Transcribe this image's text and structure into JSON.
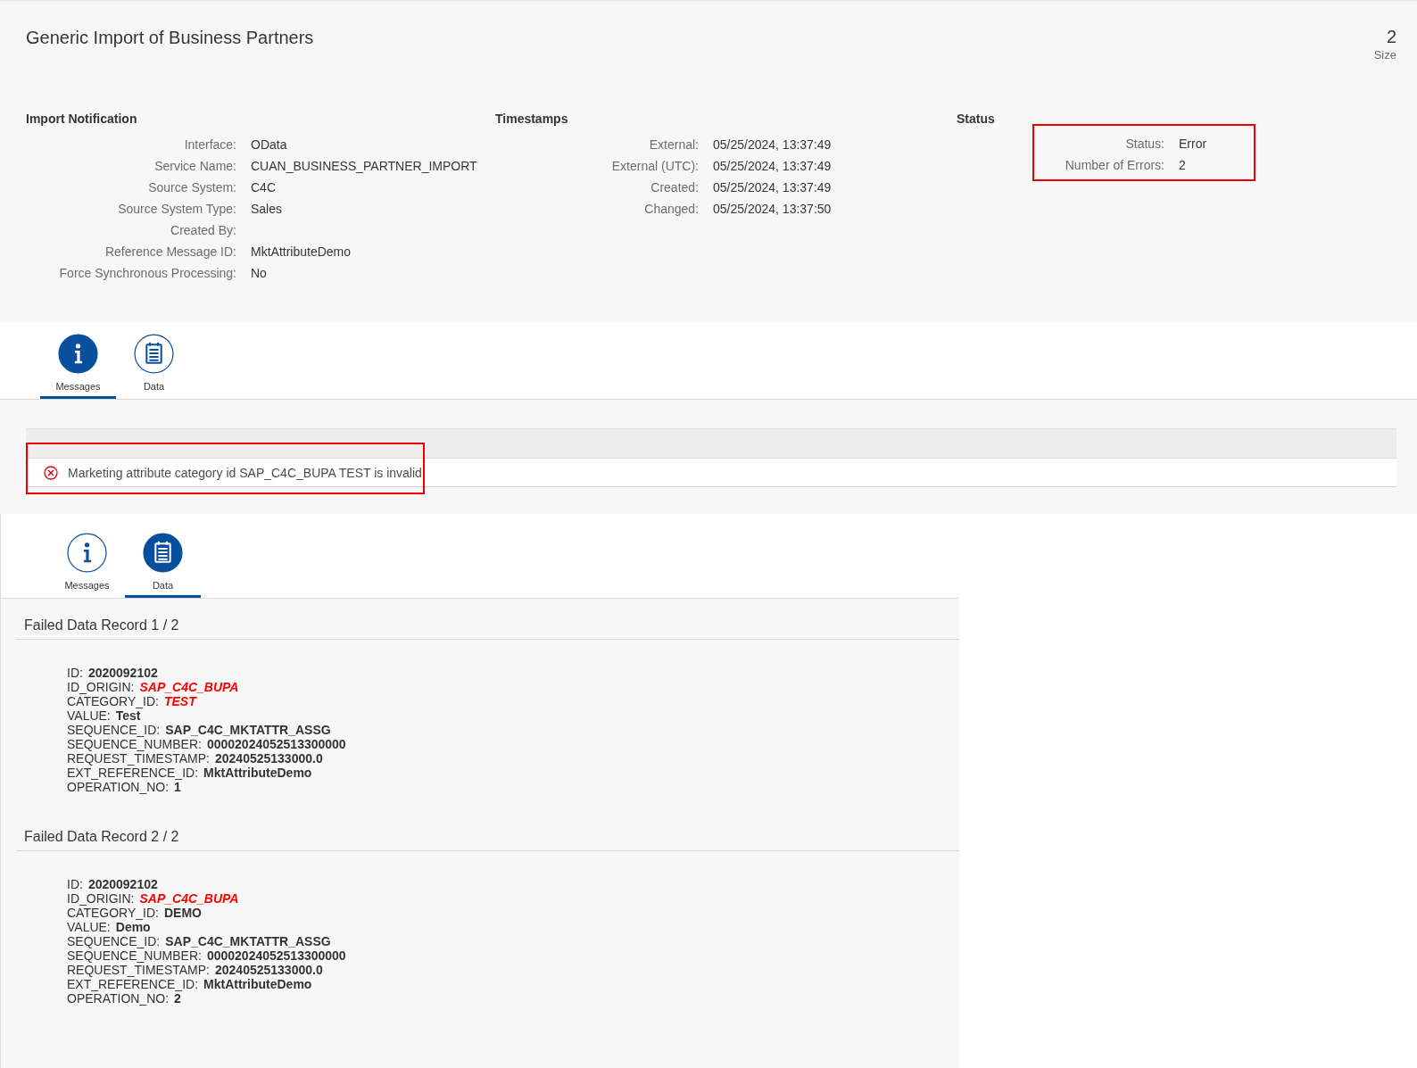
{
  "header": {
    "title": "Generic Import of Business Partners",
    "size_value": "2",
    "size_label": "Size"
  },
  "sections": [
    {
      "title": "Import Notification",
      "highlighted": false,
      "fields": [
        {
          "label": "Interface:",
          "value": "OData"
        },
        {
          "label": "Service Name:",
          "value": "CUAN_BUSINESS_PARTNER_IMPORT"
        },
        {
          "label": "Source System:",
          "value": "C4C"
        },
        {
          "label": "Source System Type:",
          "value": "Sales"
        },
        {
          "label": "Created By:"
        },
        {
          "label": "Reference Message ID:",
          "value": "MktAttributeDemo"
        },
        {
          "label": "Force Synchronous Processing:",
          "value": "No"
        }
      ]
    },
    {
      "title": "Timestamps",
      "highlighted": false,
      "fields": [
        {
          "label": "External:",
          "value": "05/25/2024, 13:37:49"
        },
        {
          "label": "External (UTC):",
          "value": "05/25/2024, 13:37:49"
        },
        {
          "label": "Created:",
          "value": "05/25/2024, 13:37:49"
        },
        {
          "label": "Changed:",
          "value": "05/25/2024, 13:37:50"
        }
      ]
    },
    {
      "title": "Status",
      "highlighted": true,
      "fields": [
        {
          "label": "Status:",
          "value": "Error"
        },
        {
          "label": "Number of Errors:",
          "value": "2"
        }
      ]
    }
  ],
  "tabs_top": [
    {
      "label": "Messages",
      "selected": true
    },
    {
      "label": "Data",
      "selected": false
    }
  ],
  "messages": {
    "highlighted": true,
    "items": [
      {
        "kind": "error",
        "text": "Marketing attribute category id SAP_C4C_BUPA TEST is invalid"
      }
    ]
  },
  "tabs_bottom": [
    {
      "label": "Messages",
      "selected": false
    },
    {
      "label": "Data",
      "selected": true
    }
  ],
  "records": [
    {
      "title": "Failed Data Record 1 / 2",
      "fields": [
        {
          "label": "ID:",
          "value": "2020092102",
          "invalid": false
        },
        {
          "label": "ID_ORIGIN:",
          "value": "SAP_C4C_BUPA",
          "invalid": true
        },
        {
          "label": "CATEGORY_ID:",
          "value": "TEST",
          "invalid": true
        },
        {
          "label": "VALUE:",
          "value": "Test",
          "invalid": false
        },
        {
          "label": "SEQUENCE_ID:",
          "value": "SAP_C4C_MKTATTR_ASSG",
          "invalid": false
        },
        {
          "label": "SEQUENCE_NUMBER:",
          "value": "00002024052513300000",
          "invalid": false
        },
        {
          "label": "REQUEST_TIMESTAMP:",
          "value": "20240525133000.0",
          "invalid": false
        },
        {
          "label": "EXT_REFERENCE_ID:",
          "value": "MktAttributeDemo",
          "invalid": false
        },
        {
          "label": "OPERATION_NO:",
          "value": "1",
          "invalid": false
        }
      ]
    },
    {
      "title": "Failed Data Record 2 / 2",
      "fields": [
        {
          "label": "ID:",
          "value": "2020092102",
          "invalid": false
        },
        {
          "label": "ID_ORIGIN:",
          "value": "SAP_C4C_BUPA",
          "invalid": true
        },
        {
          "label": "CATEGORY_ID:",
          "value": "DEMO",
          "invalid": false
        },
        {
          "label": "VALUE:",
          "value": "Demo",
          "invalid": false
        },
        {
          "label": "SEQUENCE_ID:",
          "value": "SAP_C4C_MKTATTR_ASSG",
          "invalid": false
        },
        {
          "label": "SEQUENCE_NUMBER:",
          "value": "00002024052513300000",
          "invalid": false
        },
        {
          "label": "REQUEST_TIMESTAMP:",
          "value": "20240525133000.0",
          "invalid": false
        },
        {
          "label": "EXT_REFERENCE_ID:",
          "value": "MktAttributeDemo",
          "invalid": false
        },
        {
          "label": "OPERATION_NO:",
          "value": "2",
          "invalid": false
        }
      ]
    }
  ]
}
